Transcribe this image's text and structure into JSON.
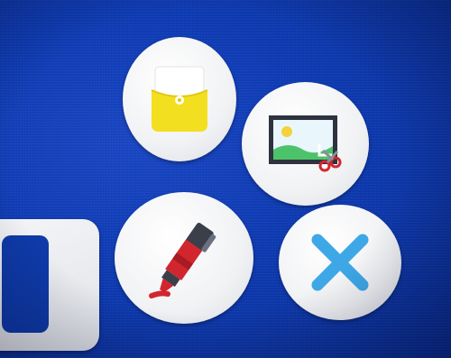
{
  "menu": {
    "buttons": [
      {
        "id": "pocket",
        "icon": "pocket-folder-icon",
        "color": "#f2df1f"
      },
      {
        "id": "image",
        "icon": "image-crop-icon",
        "color": "#2f3340"
      },
      {
        "id": "pen",
        "icon": "highlighter-pen-icon",
        "color": "#d2262e"
      },
      {
        "id": "close",
        "icon": "close-icon",
        "color": "#3ea8e6"
      }
    ]
  },
  "side_tile": {
    "icon": "phone-outline-icon"
  },
  "colors": {
    "background": "#0e3bb3",
    "button_face": "#f1f2f4",
    "accent_yellow": "#f2df1f",
    "accent_red": "#d2262e",
    "accent_blue": "#3ea8e6"
  }
}
